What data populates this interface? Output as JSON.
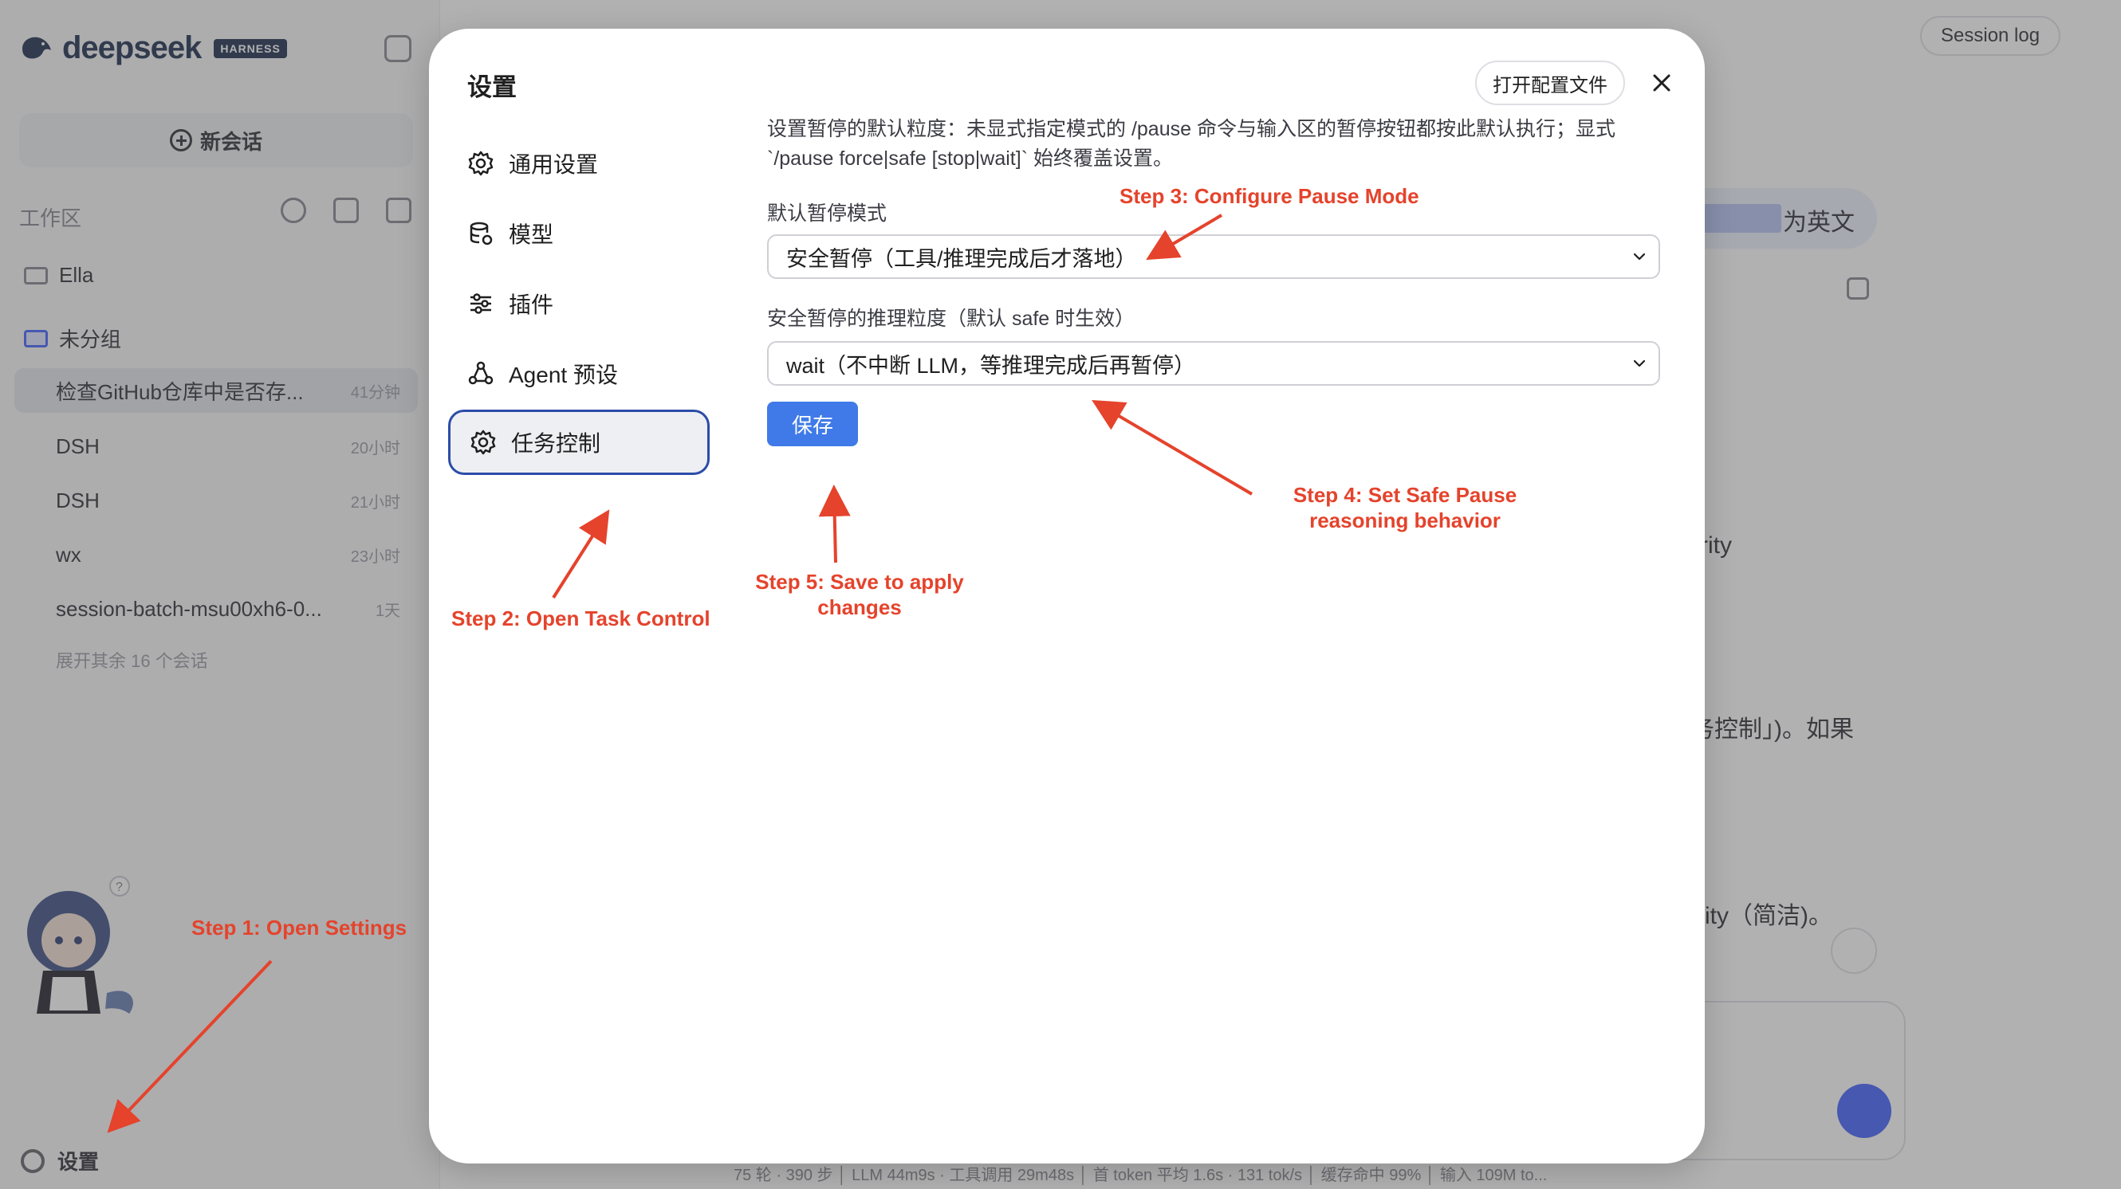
{
  "background": {
    "logo_text": "deepseek",
    "logo_badge": "HARNESS",
    "new_chat_label": "新会话",
    "workspace_label": "工作区",
    "folders": [
      {
        "label": "Ella"
      },
      {
        "label": "未分组"
      }
    ],
    "sessions": [
      {
        "title": "检查GitHub仓库中是否存...",
        "time": "41分钟"
      },
      {
        "title": "DSH",
        "time": "20小时"
      },
      {
        "title": "DSH",
        "time": "21小时"
      },
      {
        "title": "wx",
        "time": "23小时"
      },
      {
        "title": "session-batch-msu00xh6-0...",
        "time": "1天"
      }
    ],
    "expand_more": "展开其余 16 个会话",
    "settings_label": "设置",
    "session_log_label": "Session log",
    "user_message_tail": "为英文",
    "text_fragment_1": "rity",
    "text_fragment_2": "务控制」)。如果",
    "text_fragment_3": "rity（简洁)。",
    "status_bar": "75 轮 · 390 步 │ LLM 44m9s · 工具调用 29m48s │ 首 token 平均 1.6s · 131 tok/s │ 缓存命中 99% │ 输入 109M to..."
  },
  "modal": {
    "title": "设置",
    "open_config_label": "打开配置文件",
    "nav": [
      {
        "label": "通用设置",
        "icon": "gear-icon"
      },
      {
        "label": "模型",
        "icon": "database-icon"
      },
      {
        "label": "插件",
        "icon": "sliders-icon"
      },
      {
        "label": "Agent 预设",
        "icon": "agent-icon"
      },
      {
        "label": "任务控制",
        "icon": "gear-icon",
        "active": true
      }
    ],
    "description": "设置暂停的默认粒度：未显式指定模式的 /pause 命令与输入区的暂停按钮都按此默认执行；显式 `/pause force|safe [stop|wait]` 始终覆盖设置。",
    "default_mode_label": "默认暂停模式",
    "default_mode_value": "安全暂停（工具/推理完成后才落地）",
    "safe_pause_label": "安全暂停的推理粒度（默认 safe 时生效）",
    "safe_pause_value": "wait（不中断 LLM，等推理完成后再暂停）",
    "save_label": "保存"
  },
  "annotations": {
    "color": "#e5432c",
    "step1": "Step 1: Open Settings",
    "step2": "Step 2: Open Task Control",
    "step3": "Step 3: Configure Pause Mode",
    "step4_line1": "Step 4: Set Safe Pause",
    "step4_line2": "reasoning behavior",
    "step5_line1": "Step 5: Save to apply",
    "step5_line2": "changes"
  },
  "colors": {
    "accent": "#3f7ae8",
    "active_border": "#2c4ca8",
    "brand": "#4d6bfe"
  }
}
